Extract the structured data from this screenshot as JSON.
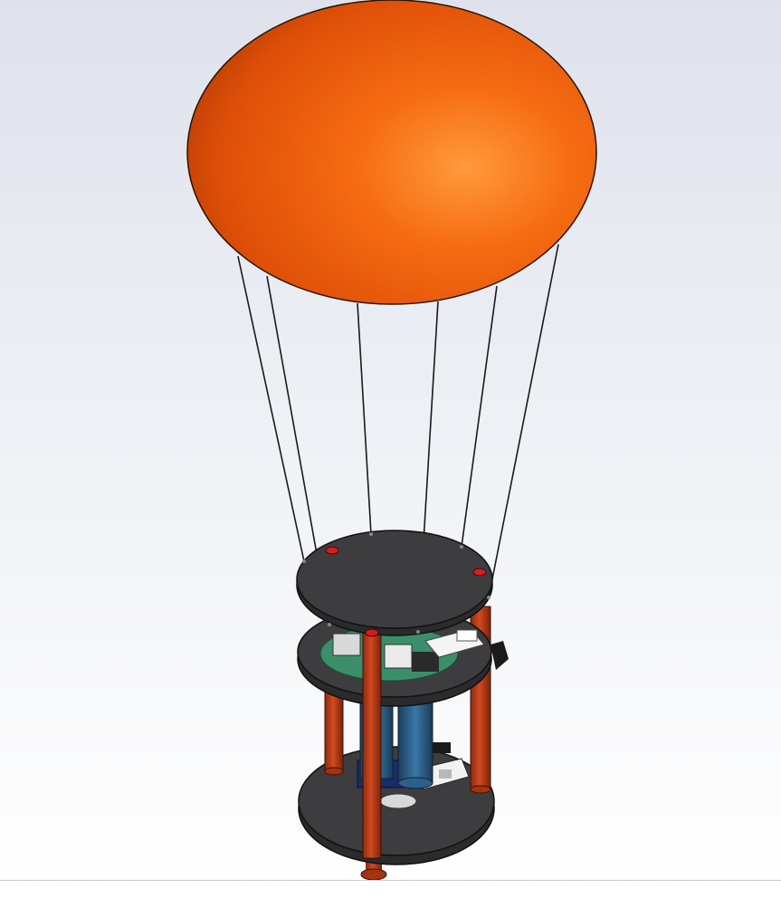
{
  "scene": {
    "subject": "cad-model",
    "colors": {
      "background_top": "#dfe2ec",
      "background_bottom": "#ffffff",
      "balloon_light": "#ff9a3c",
      "balloon_mid": "#f36a10",
      "balloon_dark": "#b63a05",
      "plate": "#3d3d3f",
      "plate_edge": "#1a1a1a",
      "rod": "#c2411c",
      "rod_dark": "#8c2a10",
      "pcb": "#3a8f6a",
      "battery": "#2c5f8a",
      "string": "#1a1a1a",
      "marker": "#d01f1f"
    },
    "icons": [
      "balloon-icon",
      "plate-icon",
      "rod-icon",
      "pcb-icon",
      "battery-icon"
    ]
  }
}
